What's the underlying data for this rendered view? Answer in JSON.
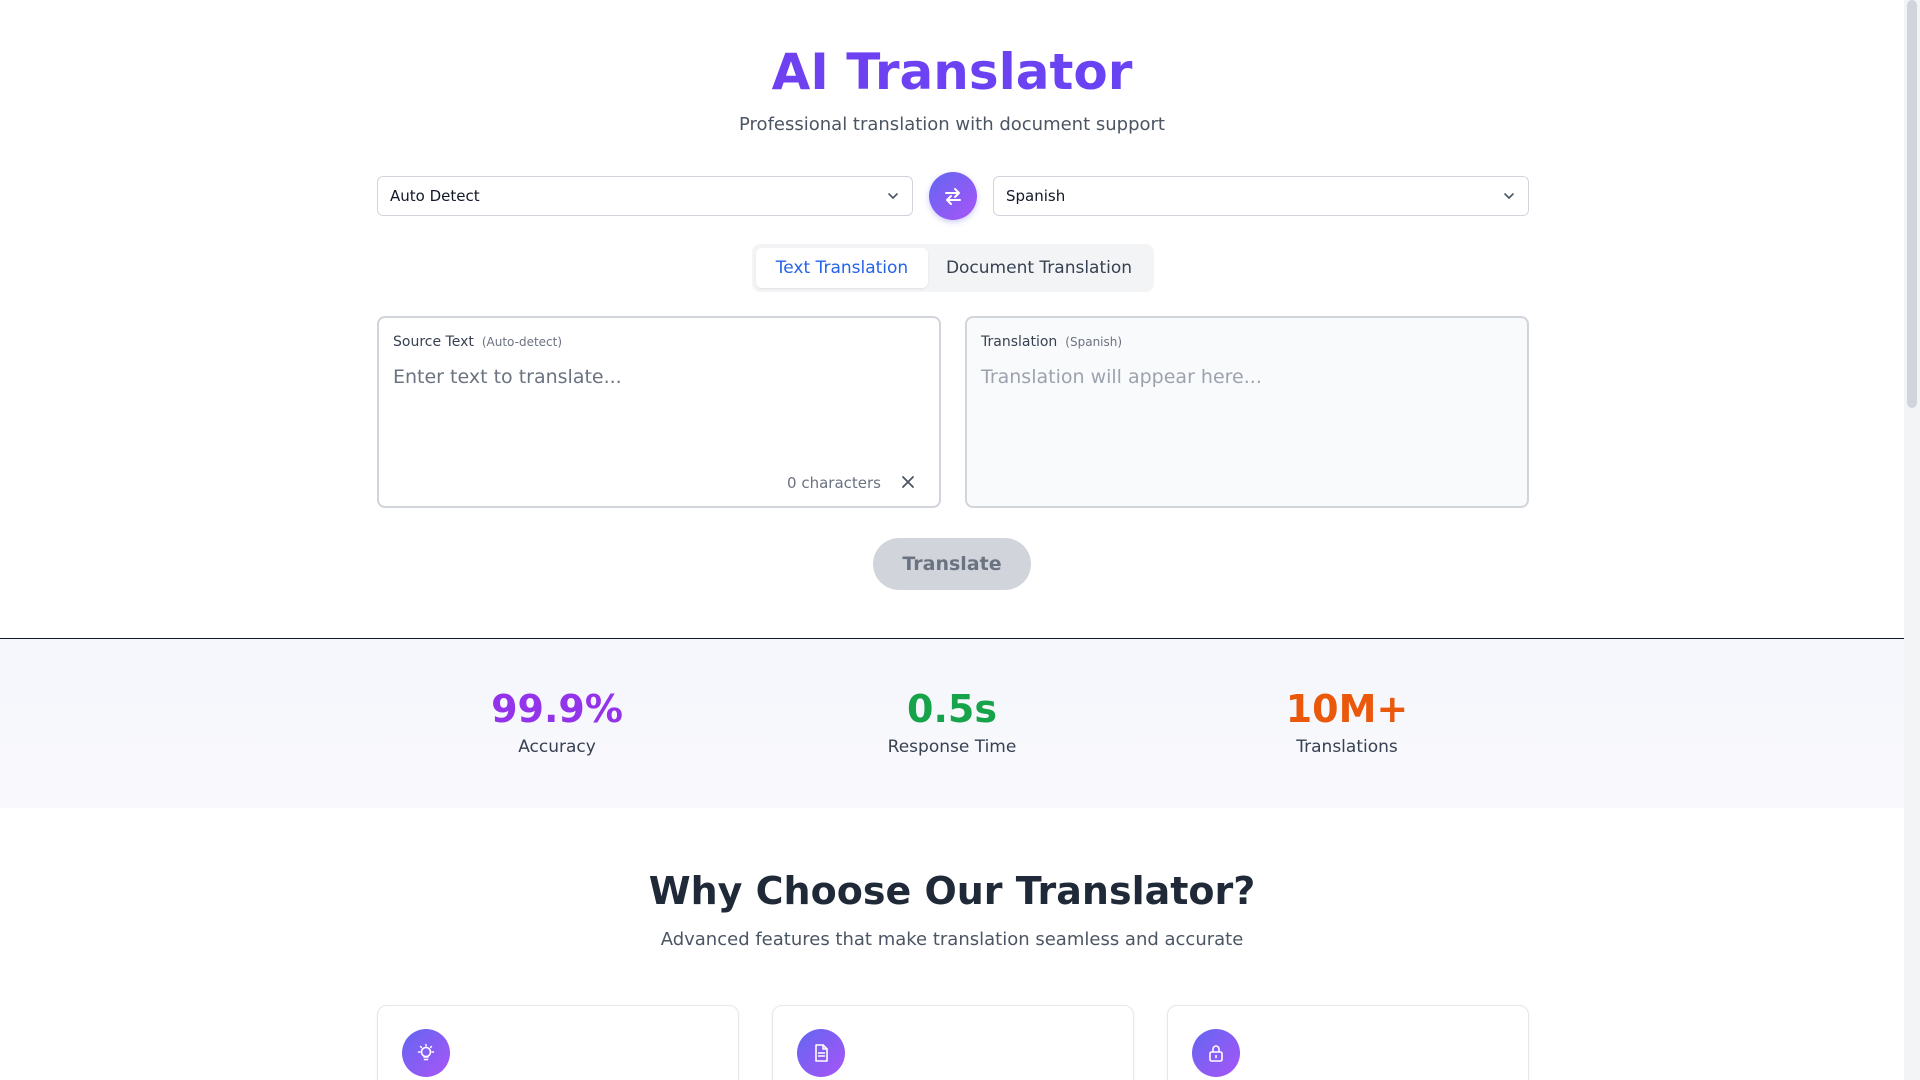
{
  "header": {
    "title": "AI Translator",
    "subtitle": "Professional translation with document support"
  },
  "languages": {
    "source_value": "Auto Detect",
    "target_value": "Spanish"
  },
  "tabs": [
    {
      "label": "Text Translation",
      "active": true
    },
    {
      "label": "Document Translation",
      "active": false
    }
  ],
  "source_panel": {
    "label": "Source Text",
    "sublabel": "(Auto-detect)",
    "placeholder": "Enter text to translate...",
    "char_count": "0 characters"
  },
  "target_panel": {
    "label": "Translation",
    "sublabel": "(Spanish)",
    "placeholder": "Translation will appear here..."
  },
  "translate_label": "Translate",
  "stats": [
    {
      "value": "99.9%",
      "label": "Accuracy",
      "color": "#9333ea"
    },
    {
      "value": "0.5s",
      "label": "Response Time",
      "color": "#16a34a"
    },
    {
      "value": "10M+",
      "label": "Translations",
      "color": "#ea580c"
    }
  ],
  "features": {
    "title": "Why Choose Our Translator?",
    "subtitle": "Advanced features that make translation seamless and accurate",
    "cards": [
      {
        "icon": "lightbulb-icon"
      },
      {
        "icon": "document-icon"
      },
      {
        "icon": "lock-icon"
      }
    ]
  },
  "colors": {
    "accent": "#6d3ff2",
    "active_tab": "#2563eb",
    "button_disabled": "#d1d5db"
  }
}
